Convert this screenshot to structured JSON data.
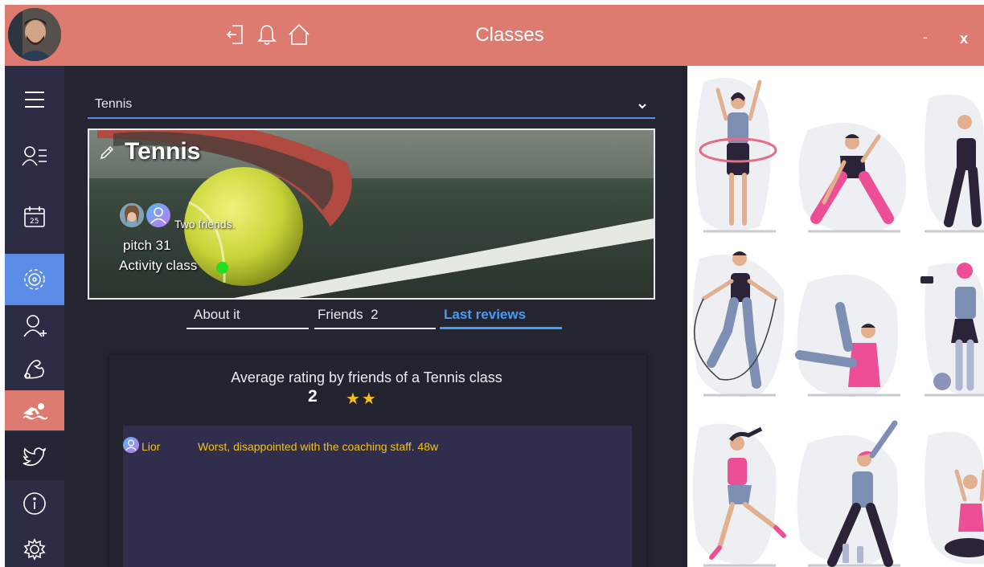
{
  "window": {
    "title": "Classes",
    "minimize_label": "-",
    "close_label": "x"
  },
  "class_select": {
    "selected": "Tennis"
  },
  "hero": {
    "title": "Tennis",
    "friends_text": "Two friends.",
    "pitch": "pitch 31",
    "activity": "Activity class"
  },
  "tabs": [
    {
      "label": "About it"
    },
    {
      "label": "Friends  2"
    },
    {
      "label": "Last reviews"
    }
  ],
  "rating": {
    "title": "Average rating by friends of a Tennis class",
    "value": "2",
    "stars": "★★"
  },
  "reviews": [
    {
      "author": "Lior",
      "text": "Worst, disappointed with the coaching staff. 48w"
    }
  ],
  "colors": {
    "header": "#de7b70",
    "sidebar": "#2c2c44",
    "active_blue": "#5b8de8",
    "main_bg": "#252532",
    "accent_tab": "#4a9bef",
    "star": "#f3c018",
    "status_green": "#22dd22"
  }
}
